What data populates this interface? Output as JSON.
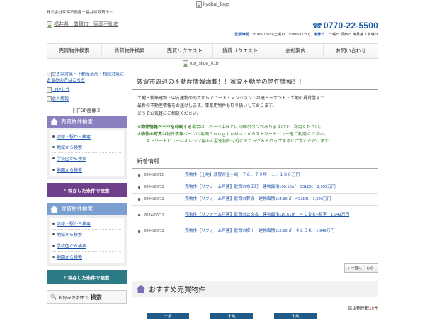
{
  "header": {
    "top_logo_alt": "kyokai_logo",
    "tagline": "株式会社家高不動産－福井県敦賀市－",
    "site_logo_alt": "福井県　敦賀市　家高不動産",
    "phone": "0770-22-5500",
    "hours_label": "営業時間",
    "hours_text": "9:00～18:00(土曜日　9:00～17:30)",
    "holiday_label": "定休日",
    "holiday_text": "日曜日 祝祭日 毎月第３水曜日"
  },
  "nav": {
    "items": [
      "売買物件検索",
      "賃貸物件検索",
      "売買リクエスト",
      "賃貸リクエスト",
      "会社案内",
      "お問い合わせ"
    ]
  },
  "slide_alt": "top_slide_01b",
  "sidebar": {
    "banner_akiya": "空き家対策・不動産活用・相続対策にお悩みの方はこちら",
    "banner_line": "LINE公式",
    "banner_job": "求人情報",
    "top_img2": "TOP画像２",
    "sale_head": "売買物件検索",
    "sale_links": [
      "沿線・駅から検索",
      "地域から検索",
      "学校区から検索",
      "地図から検索"
    ],
    "sale_save": "保存した条件で検索",
    "rent_head": "賃貸物件検索",
    "rent_links": [
      "沿線・駅から検索",
      "地域から検索",
      "学校区から検索",
      "地図から検索"
    ],
    "rent_save": "保存した条件で検索",
    "search_pre": "お好みの条件で",
    "search_big": "検索"
  },
  "main": {
    "headline": "敦賀市周辺の不動産情報満載！！家高不動産の物件情報！！",
    "intro": [
      "土地・新築建物・中古建物の売買からアパート・マンション・戸建・テナント・土地の賃貸借まで",
      "最新の不動産情報をお届けします。事業用物件も取り扱いしております。",
      "どうぞお気軽にご相談ください。"
    ],
    "note1_prefix": "※",
    "note1_bold": "物件情報ページを印刷する",
    "note1_rest": "場合は、ページ中ほどに印刷ボタンがありますのでご利用ください。",
    "note2_prefix": "※",
    "note2_bold": "物件の写真",
    "note2_rest": "は物件情報ページの地図ＧｏｏｇｌｅＭａｐからストリートビューをご利用ください。",
    "note3": "ストリートビューはオレンジ色の人型を物件付近にドラッグ＆ドロップするとご覧いただけます。",
    "news_title": "新着情報",
    "news": [
      {
        "date": "2024/06/20",
        "title": "売物件【土地】敦賀市金ヶ崎　７８．７９坪　１，１８０万円"
      },
      {
        "date": "2024/06/11",
        "title": "売物件【リフォーム戸建】敦賀市布田町　建物面積160.13㎡　5SLDK　2,999万円"
      },
      {
        "date": "2024/06/11",
        "title": "売物件【リフォーム戸建】敦賀市野坂　建物面積114.96㎡　4SLDK　1,999万円"
      },
      {
        "date": "2024/06/11",
        "title": "売物件【リフォーム戸建】敦賀市公文名　建物面積116.61㎡　４ＬＤＫ+和室　1,949万円"
      },
      {
        "date": "2024/06/11",
        "title": "売物件【リフォーム戸建】敦賀市櫛川　建物面積113.90㎡　４ＬＤＫ　1,949万円"
      }
    ],
    "more_label": "一覧はこちら",
    "rec_title": "おすすめ売買物件",
    "count_prefix": "該当物件数",
    "count_value": "10",
    "count_suffix": "件",
    "tabs": [
      "土地",
      "土地",
      "土地"
    ]
  }
}
